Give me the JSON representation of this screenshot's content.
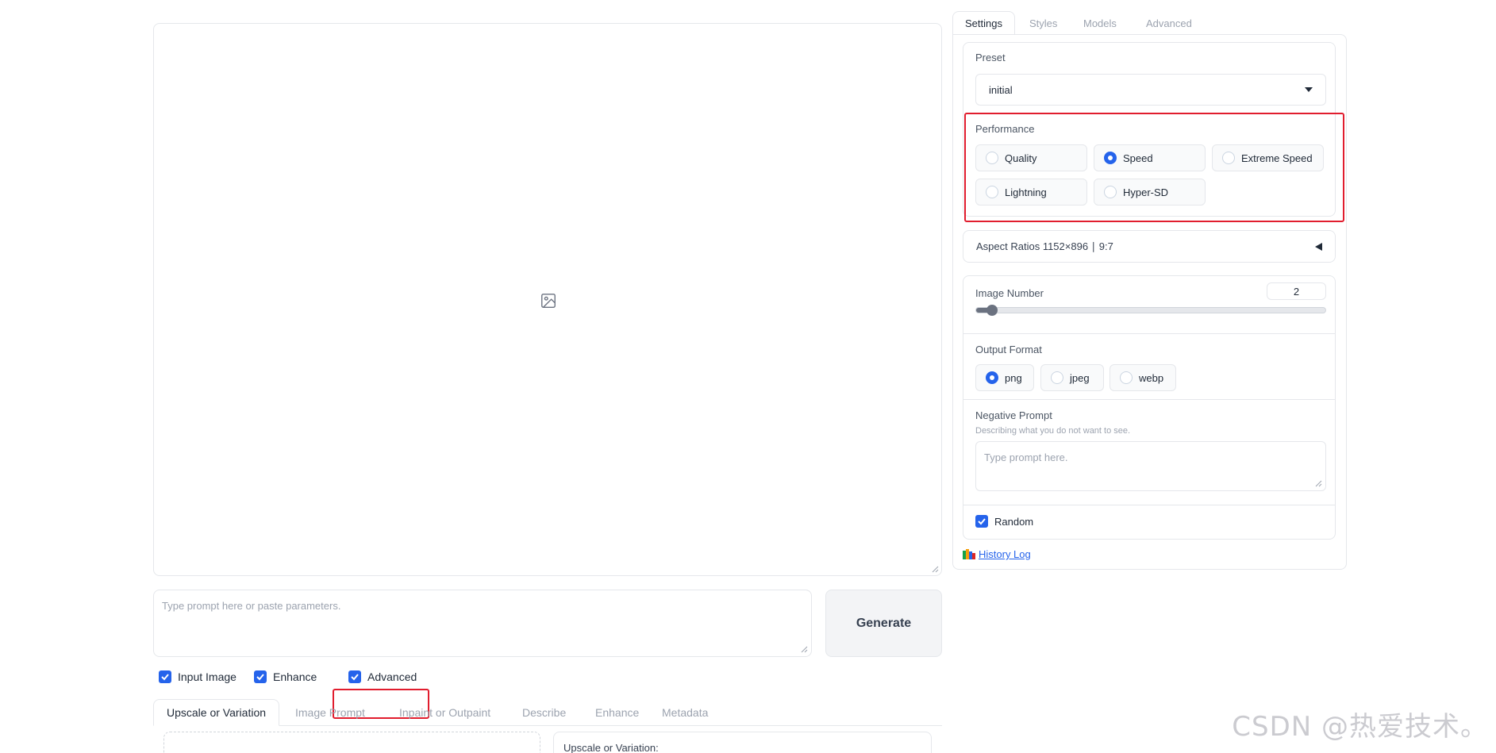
{
  "main": {
    "prompt_placeholder": "Type prompt here or paste parameters.",
    "generate_label": "Generate"
  },
  "checkboxes": {
    "input_image": "Input Image",
    "enhance": "Enhance",
    "advanced": "Advanced"
  },
  "bottom_tabs": [
    "Upscale or Variation",
    "Image Prompt",
    "Inpaint or Outpaint",
    "Describe",
    "Enhance",
    "Metadata"
  ],
  "upscale_panel_label": "Upscale or Variation:",
  "settings_tabs": [
    "Settings",
    "Styles",
    "Models",
    "Advanced"
  ],
  "preset": {
    "label": "Preset",
    "value": "initial"
  },
  "performance": {
    "label": "Performance",
    "options": [
      "Quality",
      "Speed",
      "Extreme Speed",
      "Lightning",
      "Hyper-SD"
    ],
    "selected": "Speed"
  },
  "aspect_ratios": {
    "label": "Aspect Ratios 1152×896 ∣ 9:7"
  },
  "image_number": {
    "label": "Image Number",
    "value": "2",
    "fraction": 0.03
  },
  "output_format": {
    "label": "Output Format",
    "options": [
      "png",
      "jpeg",
      "webp"
    ],
    "selected": "png"
  },
  "negative_prompt": {
    "label": "Negative Prompt",
    "sublabel": "Describing what you do not want to see.",
    "placeholder": "Type prompt here."
  },
  "random_label": "Random",
  "history_label": "History Log",
  "watermark": "CSDN @热爱技术。",
  "colors": {
    "accent": "#2563eb",
    "highlight": "#e11d2e"
  }
}
